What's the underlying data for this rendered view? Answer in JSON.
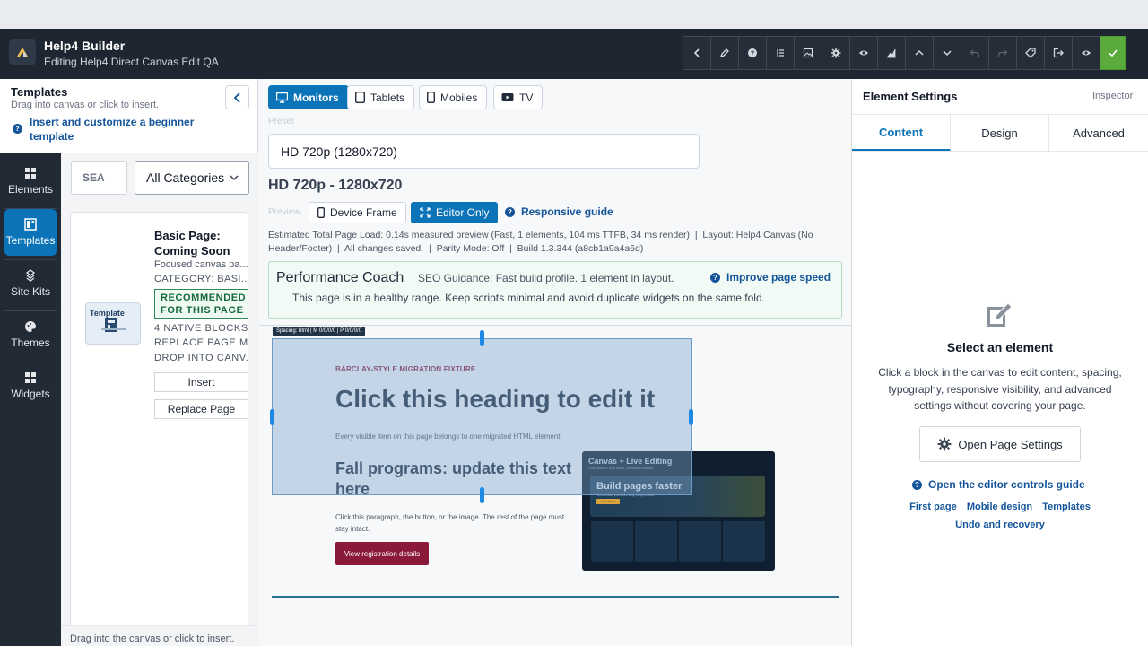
{
  "app": {
    "title": "Help4 Builder",
    "subtitle": "Editing Help4 Direct Canvas Edit QA"
  },
  "toolbar": {
    "buttons": [
      {
        "icon": "chevron-left-icon",
        "state": "normal"
      },
      {
        "icon": "pencil-icon",
        "state": "normal"
      },
      {
        "icon": "help-icon",
        "state": "normal"
      },
      {
        "icon": "list-icon",
        "state": "normal"
      },
      {
        "icon": "image-icon",
        "state": "normal"
      },
      {
        "icon": "gear-icon",
        "state": "normal"
      },
      {
        "icon": "eye-icon",
        "state": "normal"
      },
      {
        "icon": "chart-icon",
        "state": "normal"
      },
      {
        "icon": "chevron-up-icon",
        "state": "normal"
      },
      {
        "icon": "chevron-down-icon",
        "state": "normal"
      },
      {
        "icon": "undo-icon",
        "state": "disabled"
      },
      {
        "icon": "redo-icon",
        "state": "disabled"
      },
      {
        "icon": "tag-icon",
        "state": "normal"
      },
      {
        "icon": "exit-icon",
        "state": "normal"
      },
      {
        "icon": "preview-eye-icon",
        "state": "normal"
      },
      {
        "icon": "check-icon",
        "state": "primary"
      }
    ]
  },
  "leftnav": {
    "items": [
      {
        "label": "Elements",
        "icon": "grid-icon",
        "active": false
      },
      {
        "label": "Templates",
        "icon": "template-icon",
        "active": true
      },
      {
        "label": "Site Kits",
        "icon": "kit-icon",
        "active": false
      },
      {
        "label": "Themes",
        "icon": "palette-icon",
        "active": false
      },
      {
        "label": "Widgets",
        "icon": "widgets-icon",
        "active": false
      }
    ]
  },
  "templates": {
    "title": "Templates",
    "hint": "Drag into canvas or click to insert.",
    "link": "Insert and customize a beginner template",
    "search_value": "SEA",
    "category": "All Categories",
    "card": {
      "thumb_label": "Template",
      "title": "Basic Page: Coming Soon",
      "desc": "Focused canvas pa...",
      "category": "CATEGORY: BASI...",
      "badge": "RECOMMENDED FOR THIS PAGE",
      "caps1": "4 NATIVE BLOCKS",
      "caps2": "REPLACE PAGE M...",
      "caps3": "DROP INTO CANV...",
      "insert_label": "Insert",
      "replace_label": "Replace Page"
    },
    "footer": "Drag into the canvas or click to insert."
  },
  "devices": {
    "items": [
      {
        "label": "Monitors",
        "icon": "monitor-icon",
        "active": true
      },
      {
        "label": "Tablets",
        "icon": "tablet-icon",
        "active": false
      },
      {
        "label": "Mobiles",
        "icon": "mobile-icon",
        "active": false
      },
      {
        "label": "TV",
        "icon": "tv-icon",
        "active": false
      }
    ]
  },
  "preset": {
    "label": "Preset",
    "value": "HD 720p (1280x720)",
    "heading": "HD 720p - 1280x720"
  },
  "preview": {
    "label": "Preview",
    "device_frame": "Device Frame",
    "editor_only": "Editor Only",
    "guide": "Responsive guide"
  },
  "stats": {
    "load_label": "Estimated Total Page Load:",
    "load_value": "0.14s measured preview (Fast, 1 elements, 104 ms TTFB, 34 ms render)",
    "layout": "Layout: Help4 Canvas (No Header/Footer)",
    "saved": "All changes saved.",
    "parity": "Parity Mode: Off",
    "build": "Build 1.3.344 (a8cb1a9a4a6d)"
  },
  "coach": {
    "title": "Performance Coach",
    "seo": "SEO Guidance: Fast build profile. 1 element in layout.",
    "link": "Improve page speed",
    "desc": "This page is in a healthy range. Keep scripts minimal and avoid duplicate widgets on the same fold."
  },
  "canvas": {
    "spacing_tag": "Spacing: html | M 0/0/0/0 | P 0/0/0/0",
    "fixture": "BARCLAY-STYLE MIGRATION FIXTURE",
    "heading": "Click this heading to edit it",
    "every": "Every visible item on this page belongs to one migrated HTML element.",
    "subheading": "Fall programs: update this text here",
    "paragraph": "Click this paragraph, the button, or the image. The rest of the page must stay intact.",
    "button": "View registration details",
    "image": {
      "title": "Canvas + Live Editing",
      "subtitle": "Drag blocks, edit inline, preview instantly",
      "hero_title": "Build pages faster",
      "hero_sub": "Your editor controls stay easy to find",
      "hero_btn": "Get started"
    }
  },
  "inspector": {
    "title": "Element Settings",
    "inspector_label": "Inspector",
    "tabs": [
      {
        "label": "Content",
        "active": true
      },
      {
        "label": "Design",
        "active": false
      },
      {
        "label": "Advanced",
        "active": false
      }
    ],
    "select_title": "Select an element",
    "desc": "Click a block in the canvas to edit content, spacing, typography, responsive visibility, and advanced settings without covering your page.",
    "open_settings": "Open Page Settings",
    "guide": "Open the editor controls guide",
    "links": [
      "First page",
      "Mobile design",
      "Templates"
    ],
    "undo": "Undo and recovery"
  },
  "colors": {
    "accent": "#0b73b8",
    "topbar": "#1e2631",
    "primary_save": "#5aab3c",
    "canvas_button": "#8b1a3a"
  }
}
